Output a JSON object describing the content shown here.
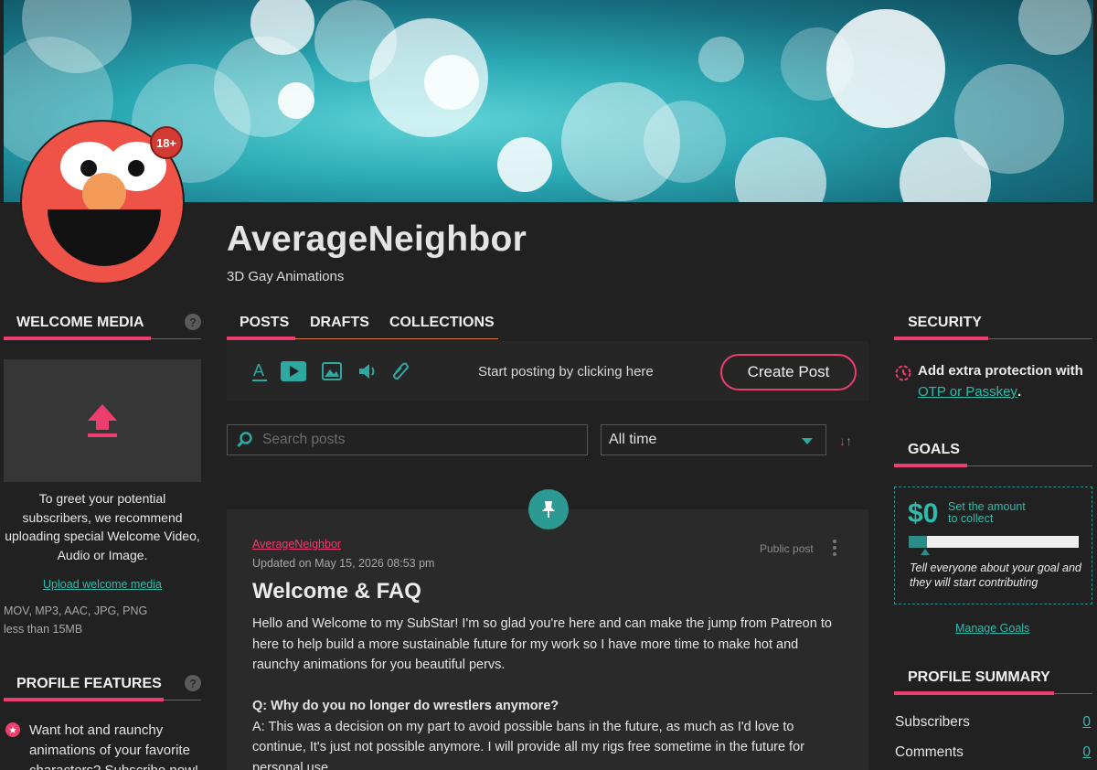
{
  "profile": {
    "name": "AverageNeighbor",
    "tagline": "3D Gay Animations",
    "age_badge": "18+"
  },
  "left": {
    "welcome_media": {
      "heading": "WELCOME MEDIA",
      "description": "To greet your potential subscribers, we recommend uploading special Welcome Video, Audio or Image.",
      "upload_link": "Upload welcome media",
      "formats": "MOV, MP3, AAC, JPG, PNG",
      "size_limit": "less than 15MB"
    },
    "profile_features": {
      "heading": "PROFILE FEATURES",
      "item": "Want hot and raunchy animations of your favorite characters? Subscribe now!"
    }
  },
  "tabs": [
    {
      "label": "POSTS"
    },
    {
      "label": "DRAFTS"
    },
    {
      "label": "COLLECTIONS"
    }
  ],
  "composer": {
    "hint": "Start posting by clicking here",
    "create_label": "Create Post"
  },
  "filters": {
    "search_placeholder": "Search posts",
    "period": "All time"
  },
  "post": {
    "author": "AverageNeighbor",
    "updated": "Updated on May 15, 2026 08:53 pm",
    "visibility": "Public post",
    "title": "Welcome & FAQ",
    "intro": "Hello and Welcome to my SubStar! I'm so glad you're here and can make the jump from Patreon to here to help build a more sustainable future for my work so I have more time to make hot and raunchy animations for you beautiful pervs.",
    "q1": "Q: Why do you no longer do wrestlers anymore?",
    "a1": "A: This was a decision on my part to avoid possible bans in the future, as much as I'd love to continue, It's just not possible anymore. I will provide all my rigs free sometime in the future for personal use."
  },
  "right": {
    "security": {
      "heading": "SECURITY",
      "text": "Add extra protection with",
      "link": "OTP or Passkey",
      "period": "."
    },
    "goals": {
      "heading": "GOALS",
      "amount": "$0",
      "set_line1": "Set the amount",
      "set_line2": "to collect",
      "progress": 0,
      "note": "Tell everyone about your goal and they will start contributing",
      "manage": "Manage Goals"
    },
    "summary": {
      "heading": "PROFILE SUMMARY",
      "rows": [
        {
          "label": "Subscribers",
          "value": "0"
        },
        {
          "label": "Comments",
          "value": "0"
        }
      ]
    }
  },
  "colors": {
    "accent_pink": "#ee3d6f",
    "accent_teal": "#2dbbac",
    "background": "#212121"
  }
}
